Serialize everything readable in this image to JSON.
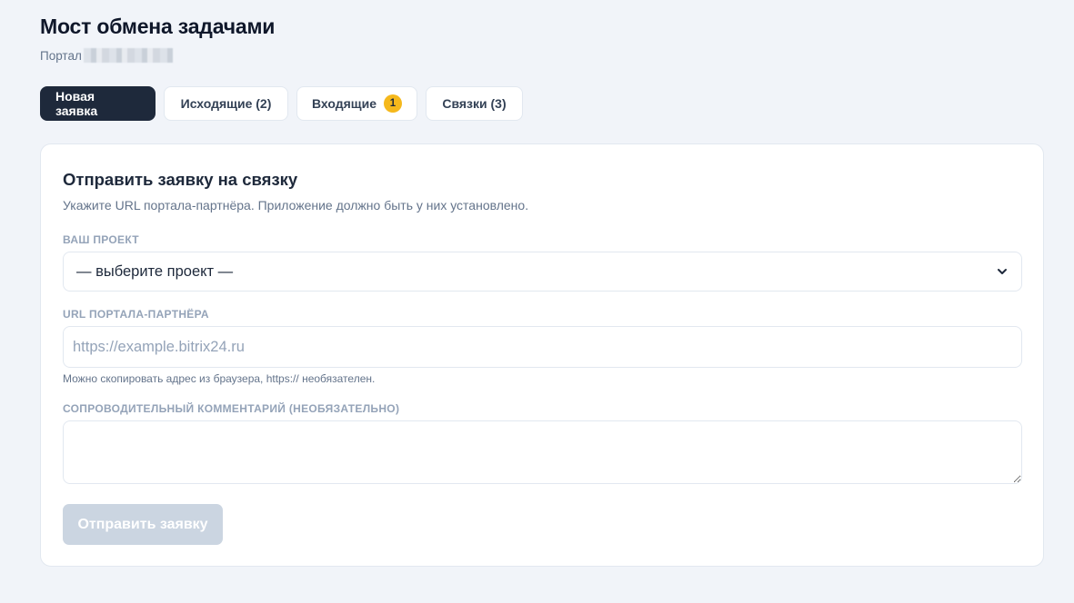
{
  "header": {
    "title": "Мост обмена задачами",
    "portal_label": "Портал"
  },
  "tabs": [
    {
      "label": "Новая заявка",
      "active": true
    },
    {
      "label": "Исходящие (2)"
    },
    {
      "label": "Входящие",
      "badge": "1"
    },
    {
      "label": "Связки (3)"
    }
  ],
  "form": {
    "title": "Отправить заявку на связку",
    "description": "Укажите URL портала-партнёра. Приложение должно быть у них установлено.",
    "project": {
      "label": "ВАШ ПРОЕКТ",
      "selected": "— выберите проект —"
    },
    "url": {
      "label": "URL ПОРТАЛА-ПАРТНЁРА",
      "placeholder": "https://example.bitrix24.ru",
      "value": "",
      "hint": "Можно скопировать адрес из браузера, https:// необязателен."
    },
    "comment": {
      "label": "СОПРОВОДИТЕЛЬНЫЙ КОММЕНТАРИЙ (НЕОБЯЗАТЕЛЬНО)",
      "value": ""
    },
    "submit_label": "Отправить заявку"
  },
  "colors": {
    "accent_dark": "#1e293b",
    "badge": "#f5b81c",
    "disabled_button": "#cbd5e1",
    "background": "#f1f4f9"
  }
}
